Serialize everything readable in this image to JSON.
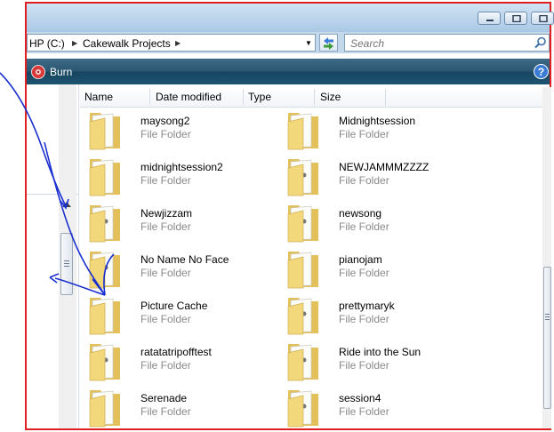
{
  "address_bar": {
    "crumbs": [
      "HP (C:)",
      "Cakewalk Projects"
    ]
  },
  "search": {
    "placeholder": "Search"
  },
  "toolbar": {
    "burn_label": "Burn"
  },
  "columns": [
    "Name",
    "Date modified",
    "Type",
    "Size"
  ],
  "items": [
    {
      "name": "maysong2",
      "type": "File Folder"
    },
    {
      "name": "Midnightsession",
      "type": "File Folder"
    },
    {
      "name": "midnightsession2",
      "type": "File Folder"
    },
    {
      "name": "NEWJAMMMZZZZ",
      "type": "File Folder"
    },
    {
      "name": "Newjizzam",
      "type": "File Folder"
    },
    {
      "name": "newsong",
      "type": "File Folder"
    },
    {
      "name": "No Name No Face",
      "type": "File Folder"
    },
    {
      "name": "pianojam",
      "type": "File Folder"
    },
    {
      "name": "Picture Cache",
      "type": "File Folder"
    },
    {
      "name": "prettymaryk",
      "type": "File Folder"
    },
    {
      "name": "ratatatripofftest",
      "type": "File Folder"
    },
    {
      "name": "Ride into the Sun",
      "type": "File Folder"
    },
    {
      "name": "Serenade",
      "type": "File Folder"
    },
    {
      "name": "session4",
      "type": "File Folder"
    }
  ],
  "colors": {
    "annotation_frame": "#e02020",
    "annotation_ink": "#1a2fd0",
    "toolbar": "#1d5470"
  }
}
